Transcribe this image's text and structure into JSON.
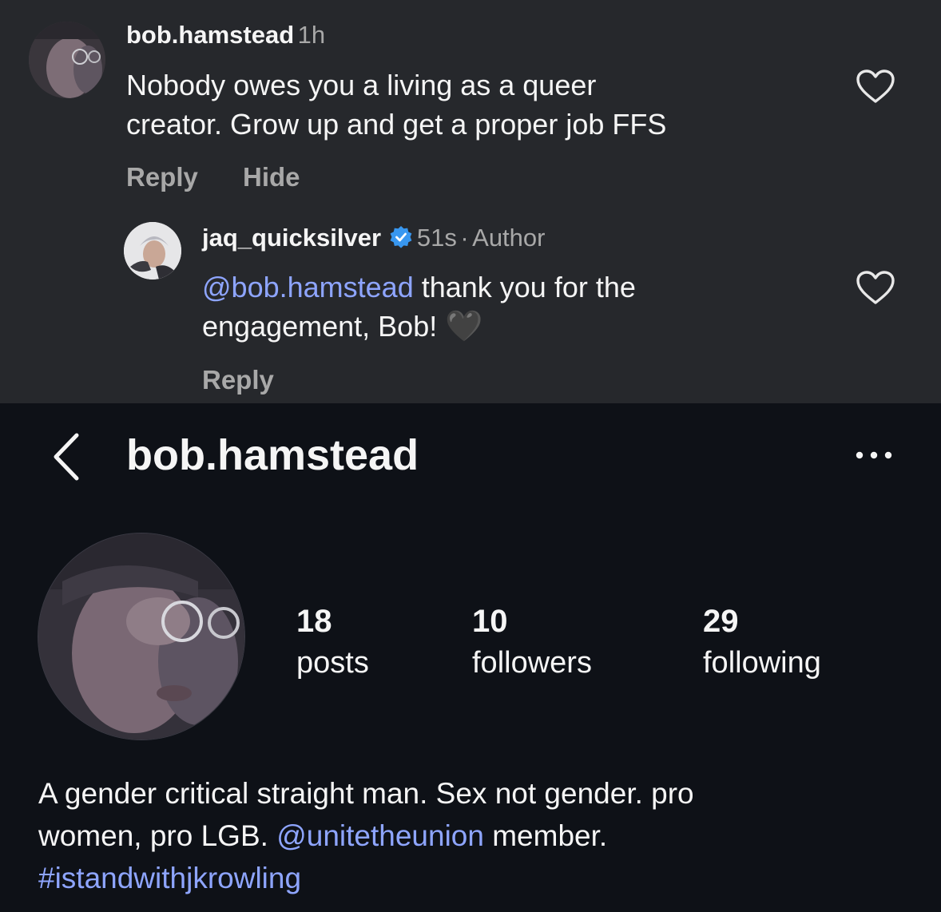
{
  "comment": {
    "username": "bob.hamstead",
    "time": "1h",
    "text_line1": "Nobody owes you a living as a queer",
    "text_line2": "creator. Grow up and get a proper job FFS",
    "reply_label": "Reply",
    "hide_label": "Hide"
  },
  "reply": {
    "username": "jaq_quicksilver",
    "time": "51s",
    "separator": "·",
    "badge": "Author",
    "mention": "@bob.hamstead",
    "text_rest": " thank you for the",
    "text_line2": "engagement, Bob!",
    "emoji": "🖤",
    "reply_label": "Reply"
  },
  "profile": {
    "back_icon": "chevron-left-icon",
    "title": "bob.hamstead",
    "more_icon": "ellipsis-icon",
    "stats": [
      {
        "value": "18",
        "label": "posts"
      },
      {
        "value": "10",
        "label": "followers"
      },
      {
        "value": "29",
        "label": "following"
      }
    ],
    "bio_line1": "A gender critical straight man. Sex not gender. pro",
    "bio_line2_start": "women, pro LGB. ",
    "bio_mention": "@unitetheunion",
    "bio_line2_end": " member.",
    "bio_hashtag": "#istandwithjkrowling"
  },
  "colors": {
    "comments_bg": "#26282c",
    "profile_bg": "#0e1117",
    "link": "#8ea5ff",
    "verified": "#3897f0",
    "muted": "#a8a8a8"
  }
}
